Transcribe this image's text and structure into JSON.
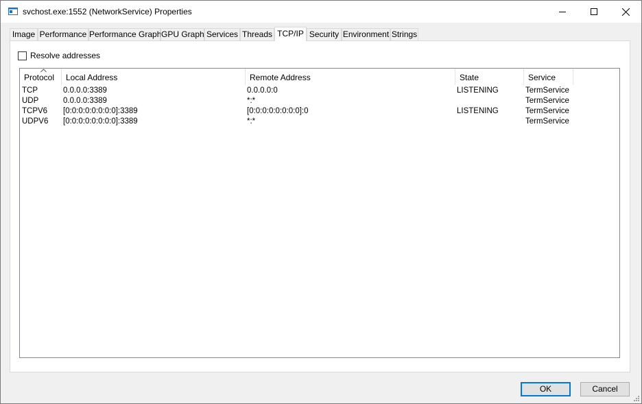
{
  "window": {
    "title": "svchost.exe:1552 (NetworkService) Properties",
    "icon": "window-app-icon"
  },
  "tabs": [
    {
      "label": "Image"
    },
    {
      "label": "Performance"
    },
    {
      "label": "Performance Graph"
    },
    {
      "label": "GPU Graph"
    },
    {
      "label": "Services"
    },
    {
      "label": "Threads"
    },
    {
      "label": "TCP/IP",
      "active": true
    },
    {
      "label": "Security"
    },
    {
      "label": "Environment"
    },
    {
      "label": "Strings"
    }
  ],
  "resolve_addresses": {
    "label": "Resolve addresses",
    "checked": false
  },
  "table": {
    "columns": [
      "Protocol",
      "Local Address",
      "Remote Address",
      "State",
      "Service"
    ],
    "sorted_column": "Protocol",
    "rows": [
      [
        "TCP",
        "0.0.0.0:3389",
        "0.0.0.0:0",
        "LISTENING",
        "TermService"
      ],
      [
        "UDP",
        "0.0.0.0:3389",
        "*:*",
        "",
        "TermService"
      ],
      [
        "TCPV6",
        "[0:0:0:0:0:0:0:0]:3389",
        "[0:0:0:0:0:0:0:0]:0",
        "LISTENING",
        "TermService"
      ],
      [
        "UDPV6",
        "[0:0:0:0:0:0:0:0]:3389",
        "*:*",
        "",
        "TermService"
      ]
    ]
  },
  "buttons": {
    "ok": "OK",
    "cancel": "Cancel"
  },
  "colors": {
    "accent": "#0078d7",
    "border": "#828790"
  }
}
